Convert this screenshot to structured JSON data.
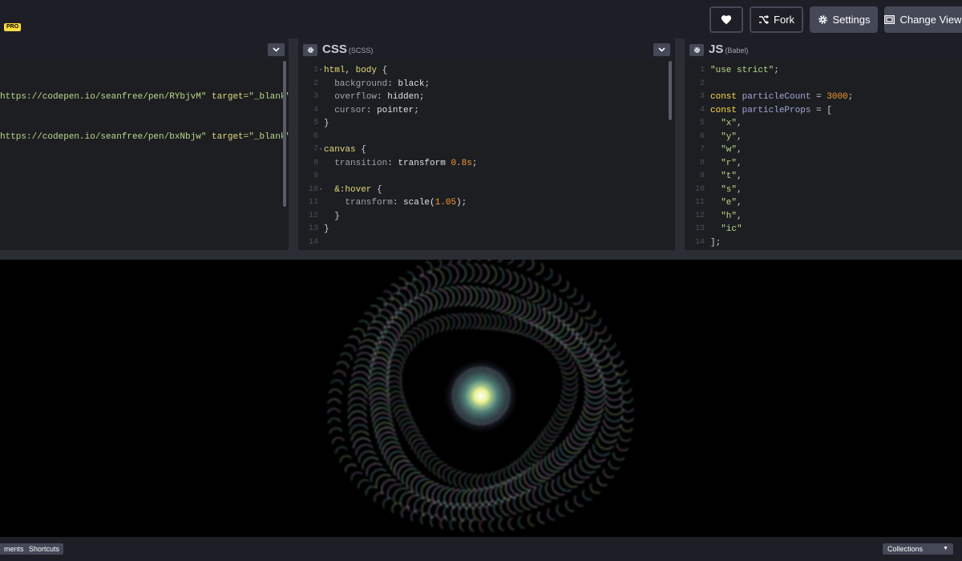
{
  "header": {
    "pro_badge": "PRO",
    "fork_label": "Fork",
    "settings_label": "Settings",
    "change_view_label": "Change View"
  },
  "html_pane": {
    "lines": [
      {
        "y": 45,
        "pre": "https://codepen.io/seanfree/pen/RYbjvM\"",
        "attr": " target=",
        "str": "\"_blank\"",
        "post": ")"
      },
      {
        "y": 95,
        "pre": "https://codepen.io/seanfree/pen/bxNbjw\"",
        "attr": " target=",
        "str": "\"_blank\"",
        "post": ")"
      }
    ]
  },
  "css_pane": {
    "title": "CSS",
    "subtitle": "(SCSS)",
    "line_numbers": [
      "1",
      "2",
      "3",
      "4",
      "5",
      "6",
      "7",
      "8",
      "9",
      "10",
      "11",
      "12",
      "13",
      "14"
    ]
  },
  "js_pane": {
    "title": "JS",
    "subtitle": "(Babel)",
    "line_numbers": [
      "1",
      "2",
      "3",
      "4",
      "5",
      "6",
      "7",
      "8",
      "9",
      "10",
      "11",
      "12",
      "13",
      "14"
    ]
  },
  "footer": {
    "comments_label": "ments",
    "shortcuts_label": "Shortcuts",
    "collections_label": "Collections"
  },
  "colors": {
    "accent": "#ffdd40",
    "button": "#444857",
    "editor_bg": "#1d1e22"
  }
}
